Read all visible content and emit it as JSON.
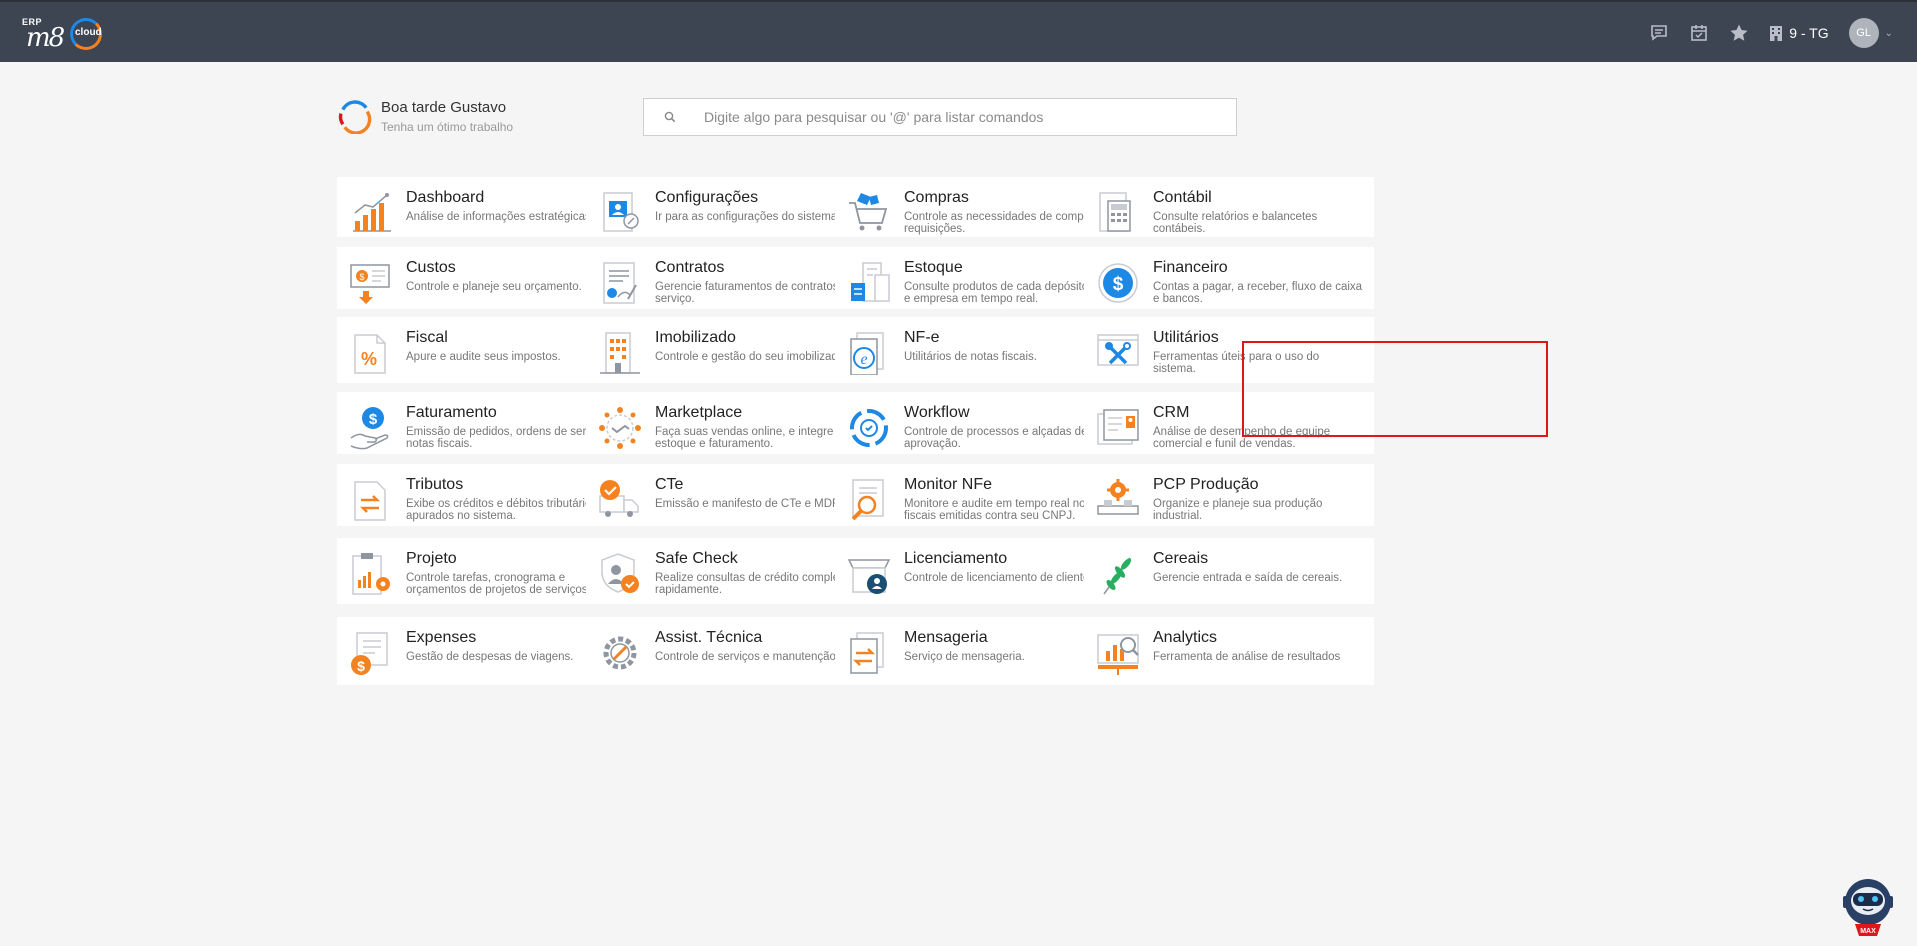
{
  "header": {
    "logo_erp": "ERP",
    "logo_brand": "m8",
    "logo_cloud": "cloud",
    "company": "9 - TG",
    "avatar": "GL"
  },
  "greeting": {
    "title": "Boa tarde Gustavo",
    "subtitle": "Tenha um ótimo trabalho"
  },
  "search": {
    "placeholder": "Digite algo para pesquisar ou '@' para listar comandos"
  },
  "highlighted_module": "Utilitários",
  "colors": {
    "topbar": "#3d4452",
    "orange": "#f58220",
    "blue": "#1e88e5",
    "highlight": "#e0161d"
  },
  "modules": [
    {
      "title": "Dashboard",
      "desc": "Análise de informações estratégicas.",
      "icon": "bar-chart-icon"
    },
    {
      "title": "Configurações",
      "desc": "Ir para as configurações do sistema.",
      "icon": "settings-profile-icon"
    },
    {
      "title": "Compras",
      "desc": "Controle as necessidades de compras e requisições.",
      "icon": "shopping-cart-icon"
    },
    {
      "title": "Contábil",
      "desc": "Consulte relatórios e balancetes contábeis.",
      "icon": "calculator-document-icon"
    },
    {
      "title": "Custos",
      "desc": "Controle e planeje seu orçamento.",
      "icon": "money-bill-icon"
    },
    {
      "title": "Contratos",
      "desc": "Gerencie faturamentos de contratos de serviço.",
      "icon": "contract-icon"
    },
    {
      "title": "Estoque",
      "desc": "Consulte produtos de cada depósito, filial e empresa em tempo real.",
      "icon": "warehouse-icon"
    },
    {
      "title": "Financeiro",
      "desc": "Contas a pagar, a receber, fluxo de caixa e bancos.",
      "icon": "dollar-coin-icon"
    },
    {
      "title": "Fiscal",
      "desc": "Apure e audite seus impostos.",
      "icon": "percent-document-icon"
    },
    {
      "title": "Imobilizado",
      "desc": "Controle e gestão do seu imobilizado.",
      "icon": "building-icon"
    },
    {
      "title": "NF-e",
      "desc": "Utilitários de notas fiscais.",
      "icon": "e-document-icon"
    },
    {
      "title": "Utilitários",
      "desc": "Ferramentas úteis para o uso do sistema.",
      "icon": "tools-icon"
    },
    {
      "title": "Faturamento",
      "desc": "Emissão de pedidos, ordens de serviço e notas fiscais.",
      "icon": "billing-hand-icon"
    },
    {
      "title": "Marketplace",
      "desc": "Faça suas vendas online, e integre ao estoque e faturamento.",
      "icon": "network-handshake-icon"
    },
    {
      "title": "Workflow",
      "desc": "Controle de processos e alçadas de aprovação.",
      "icon": "workflow-cycle-icon"
    },
    {
      "title": "CRM",
      "desc": "Análise de desempenho de equipe comercial e funil de vendas.",
      "icon": "crm-card-icon"
    },
    {
      "title": "Tributos",
      "desc": "Exibe os créditos e débitos tributários apurados no sistema.",
      "icon": "tax-transfer-icon"
    },
    {
      "title": "CTe",
      "desc": "Emissão e manifesto de CTe e MDFe.",
      "icon": "truck-check-icon"
    },
    {
      "title": "Monitor NFe",
      "desc": "Monitore e audite em tempo real notas fiscais emitidas contra seu CNPJ.",
      "icon": "magnifier-document-icon"
    },
    {
      "title": "PCP Produção",
      "desc": "Organize e planeje sua produção industrial.",
      "icon": "production-gear-icon"
    },
    {
      "title": "Projeto",
      "desc": "Controle tarefas, cronograma e orçamentos de projetos de serviços.",
      "icon": "project-clipboard-icon"
    },
    {
      "title": "Safe Check",
      "desc": "Realize consultas de crédito completas rapidamente.",
      "icon": "shield-check-icon"
    },
    {
      "title": "Licenciamento",
      "desc": "Controle de licenciamento de clientes.",
      "icon": "license-store-icon"
    },
    {
      "title": "Cereais",
      "desc": "Gerencie entrada e saída de cereais.",
      "icon": "grain-leaf-icon"
    },
    {
      "title": "Expenses",
      "desc": "Gestão de despesas de viagens.",
      "icon": "expenses-coin-icon"
    },
    {
      "title": "Assist. Técnica",
      "desc": "Controle de serviços e manutenção",
      "icon": "gear-wrench-icon"
    },
    {
      "title": "Mensageria",
      "desc": "Serviço de mensageria.",
      "icon": "message-transfer-icon"
    },
    {
      "title": "Analytics",
      "desc": "Ferramenta de análise de resultados",
      "icon": "analytics-monitor-icon"
    }
  ],
  "assistant": {
    "label": "MAX"
  }
}
